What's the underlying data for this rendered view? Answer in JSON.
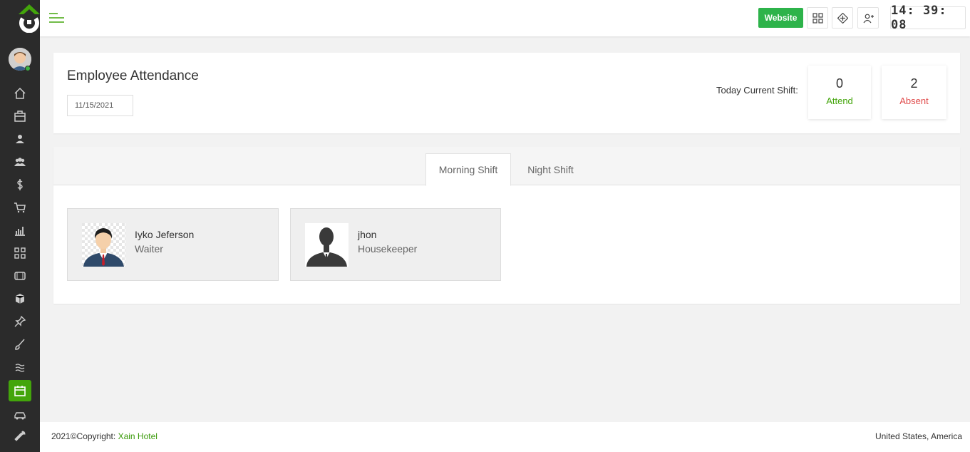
{
  "header": {
    "website_label": "Website",
    "clock": "14:39:08",
    "icons": [
      "grid-icon",
      "move-icon",
      "add-user-icon"
    ]
  },
  "sidebar": {
    "items": [
      "home-icon",
      "luggage-icon",
      "user-icon",
      "users-icon",
      "dollar-icon",
      "cart-icon",
      "chart-icon",
      "apps-icon",
      "card-icon",
      "cube-icon",
      "pin-icon",
      "brush-icon",
      "wave-icon",
      "calendar-icon",
      "car-icon",
      "wrench-icon"
    ],
    "active": "calendar-icon"
  },
  "attendance": {
    "title": "Employee Attendance",
    "date": "11/15/2021",
    "shift_label": "Today Current Shift:",
    "attend": {
      "count": "0",
      "label": "Attend",
      "color": "#43a50b"
    },
    "absent": {
      "count": "2",
      "label": "Absent",
      "color": "#e04b4b"
    }
  },
  "shifts": {
    "tabs": [
      "Morning Shift",
      "Night Shift"
    ],
    "active_tab": "Morning Shift",
    "employees": [
      {
        "name": "Iyko Jeferson",
        "role": "Waiter"
      },
      {
        "name": "jhon",
        "role": "Housekeeper"
      }
    ]
  },
  "footer": {
    "copyright": "2021©Copyright: ",
    "brand": "Xain Hotel",
    "region": "United States, America"
  },
  "colors": {
    "accent": "#2db34a",
    "sidebar": "#2b2b2b",
    "active_nav": "#43a50b"
  }
}
